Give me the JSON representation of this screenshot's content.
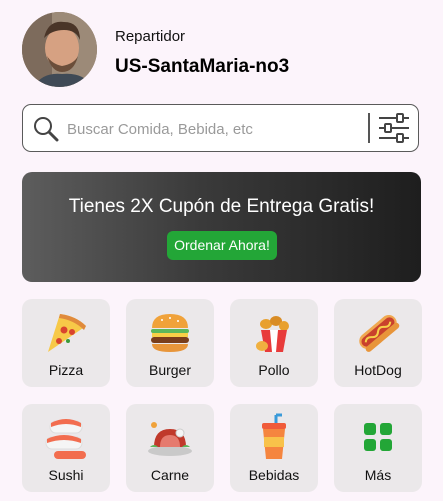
{
  "profile": {
    "role": "Repartidor",
    "username": "US-SantaMaria-no3"
  },
  "search": {
    "placeholder": "Buscar Comida, Bebida, etc"
  },
  "banner": {
    "title": "Tienes 2X Cupón de Entrega Gratis!",
    "button": "Ordenar Ahora!"
  },
  "colors": {
    "accent": "#23a637",
    "background": "#fcf4fb",
    "tile": "#ebe8ea"
  },
  "categories": [
    {
      "label": "Pizza",
      "icon": "pizza-icon"
    },
    {
      "label": "Burger",
      "icon": "burger-icon"
    },
    {
      "label": "Pollo",
      "icon": "chicken-icon"
    },
    {
      "label": "HotDog",
      "icon": "hotdog-icon"
    },
    {
      "label": "Sushi",
      "icon": "sushi-icon"
    },
    {
      "label": "Carne",
      "icon": "meat-icon"
    },
    {
      "label": "Bebidas",
      "icon": "drink-icon"
    },
    {
      "label": "Más",
      "icon": "grid-icon"
    }
  ]
}
